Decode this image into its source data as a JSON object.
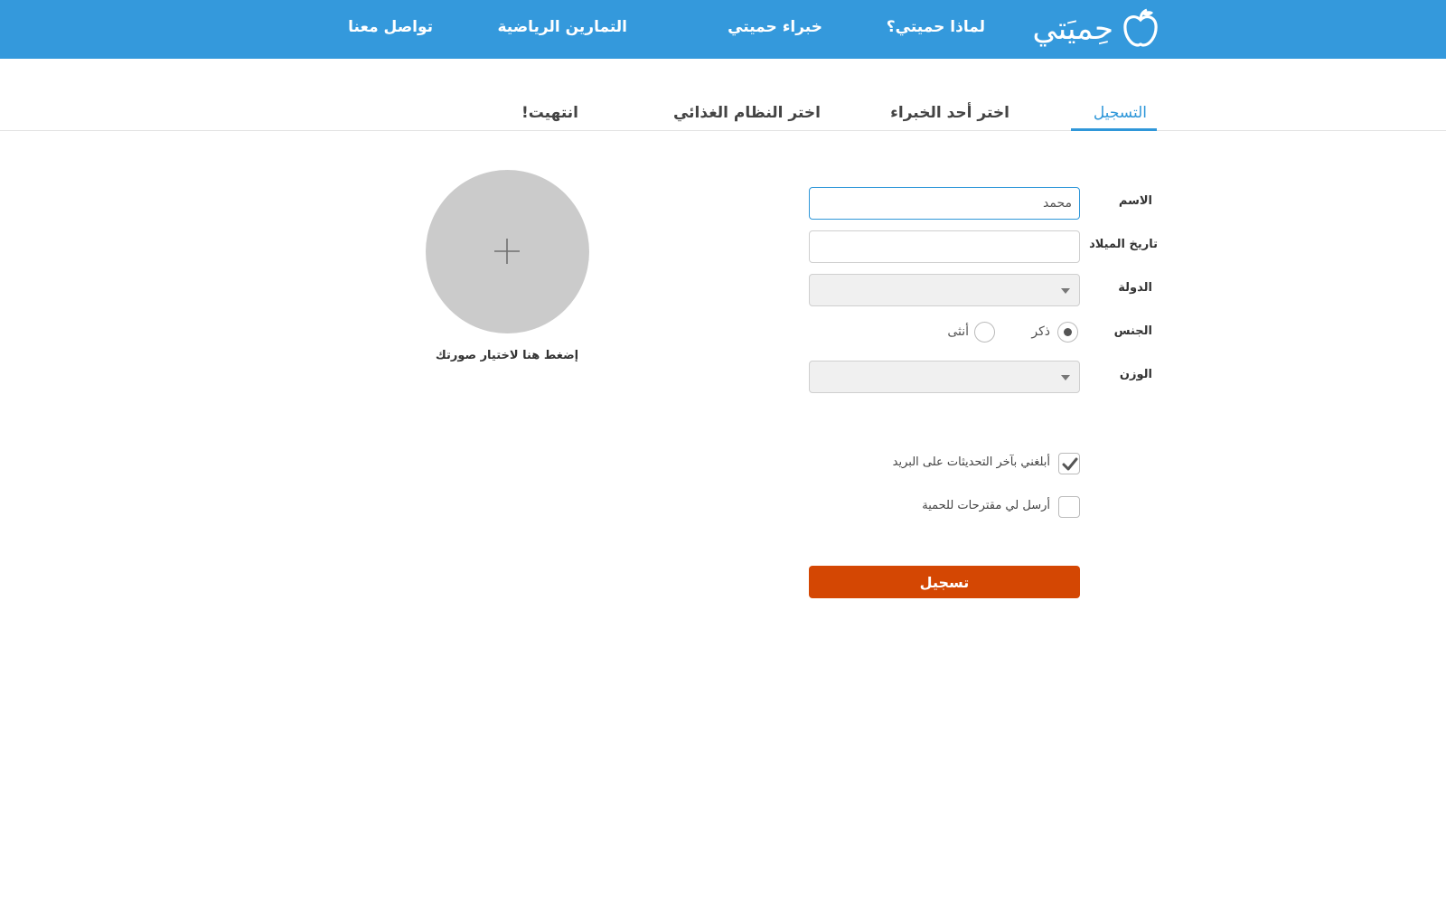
{
  "brand": {
    "name": "حِميَتي",
    "icon": "apple-icon",
    "color": "#3499dc"
  },
  "nav": {
    "items": [
      {
        "label": "لماذا حميتي؟"
      },
      {
        "label": "خبراء حميتي"
      },
      {
        "label": "التمارين الرياضية"
      },
      {
        "label": "تواصل معنا"
      }
    ]
  },
  "steps": {
    "items": [
      {
        "label": "التسجيل",
        "active": true
      },
      {
        "label": "اختر أحد الخبراء"
      },
      {
        "label": "اختر النظام الغذائي"
      },
      {
        "label": "انتهيت!"
      }
    ],
    "accent_color": "#2f97d9"
  },
  "form": {
    "name": {
      "label": "الاسم",
      "value": "محمد"
    },
    "birthdate": {
      "label": "تاريخ الميلاد",
      "value": ""
    },
    "country": {
      "label": "الدولة",
      "value": ""
    },
    "gender": {
      "label": "الجنس",
      "options": [
        {
          "label": "ذكر",
          "selected": true
        },
        {
          "label": "أنثى",
          "selected": false
        }
      ]
    },
    "weight": {
      "label": "الوزن",
      "value": ""
    },
    "checkboxes": [
      {
        "label": "أبلغني بآخر التحديثات على البريد",
        "checked": true
      },
      {
        "label": "أرسل لي مقترحات للحمية",
        "checked": false
      }
    ],
    "submit_label": "تسجيل",
    "submit_color": "#d44703"
  },
  "photo": {
    "caption": "إضغط هنا لاختيار صورتك",
    "icon": "plus-icon"
  }
}
